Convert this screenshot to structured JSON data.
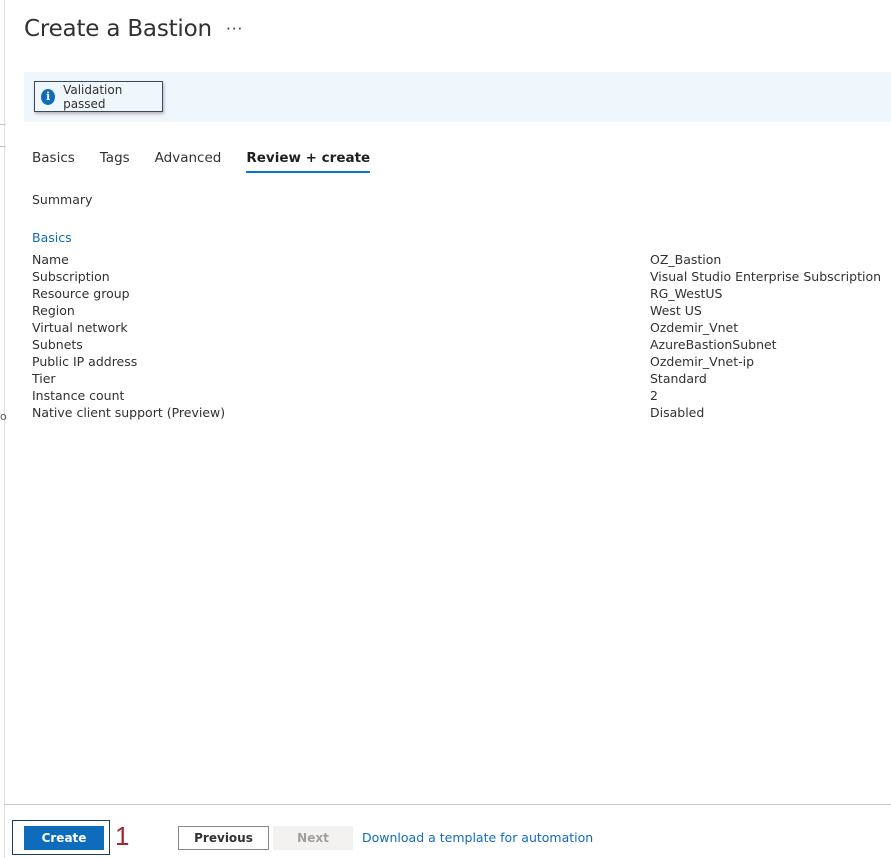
{
  "page": {
    "title": "Create a Bastion",
    "more_label": "···"
  },
  "edge": {
    "char": "o"
  },
  "banner": {
    "icon": "info-icon",
    "text": "Validation passed"
  },
  "tabs": [
    {
      "label": "Basics",
      "active": false
    },
    {
      "label": "Tags",
      "active": false
    },
    {
      "label": "Advanced",
      "active": false
    },
    {
      "label": "Review + create",
      "active": true
    }
  ],
  "summary": {
    "heading": "Summary",
    "section": "Basics"
  },
  "rows": [
    {
      "key": "Name",
      "value": "OZ_Bastion"
    },
    {
      "key": "Subscription",
      "value": "Visual Studio Enterprise Subscription"
    },
    {
      "key": "Resource group",
      "value": "RG_WestUS"
    },
    {
      "key": "Region",
      "value": "West US"
    },
    {
      "key": "Virtual network",
      "value": "Ozdemir_Vnet"
    },
    {
      "key": "Subnets",
      "value": "AzureBastionSubnet"
    },
    {
      "key": "Public IP address",
      "value": "Ozdemir_Vnet-ip"
    },
    {
      "key": "Tier",
      "value": "Standard"
    },
    {
      "key": "Instance count",
      "value": "2"
    },
    {
      "key": "Native client support (Preview)",
      "value": "Disabled"
    }
  ],
  "footer": {
    "create_label": "Create",
    "annotation": "1",
    "previous_label": "Previous",
    "next_label": "Next",
    "download_label": "Download a template for automation"
  },
  "colors": {
    "accent": "#0f6cbd",
    "banner_bg": "#eff6fc",
    "annotation": "#a4262c"
  }
}
